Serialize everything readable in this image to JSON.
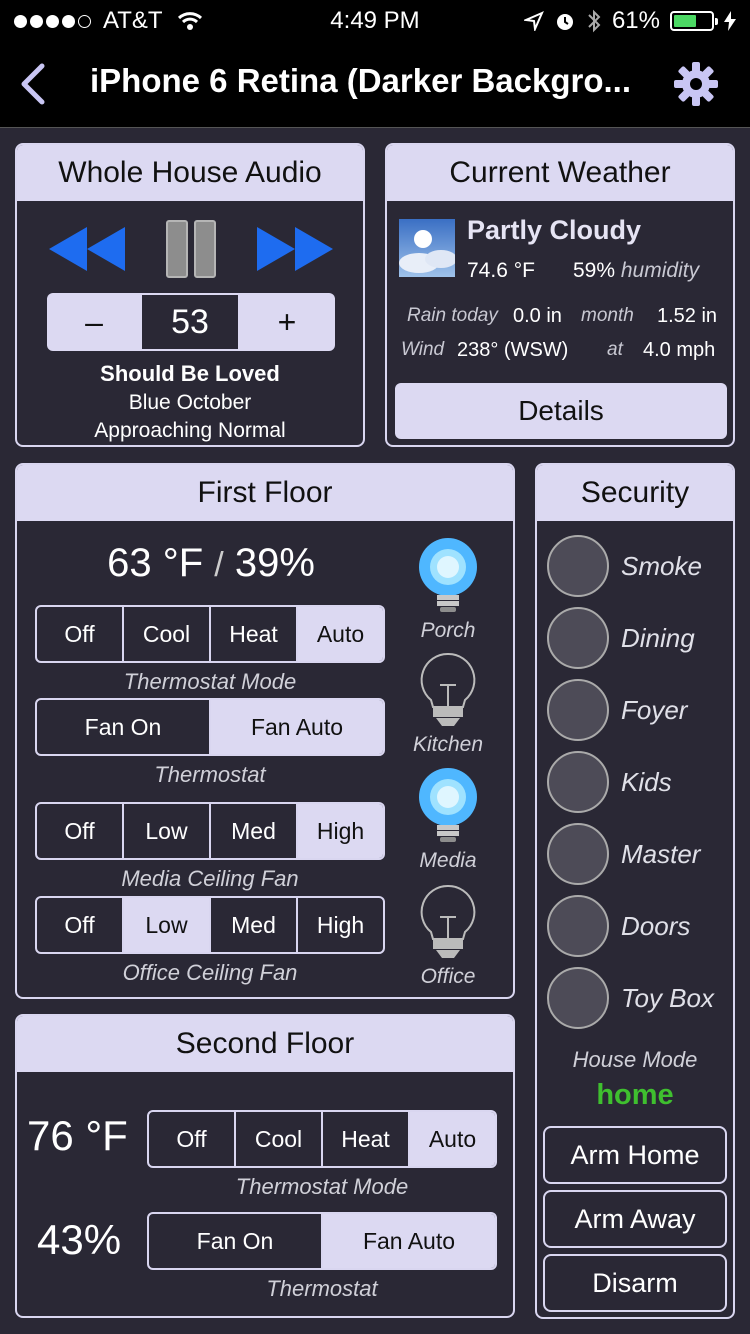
{
  "status": {
    "carrier": "AT&T",
    "time": "4:49 PM",
    "battery": "61%",
    "battery_level": 0.61
  },
  "nav": {
    "title": "iPhone 6 Retina (Darker Backgro..."
  },
  "audio": {
    "title": "Whole House Audio",
    "volume": "53",
    "minus": "–",
    "plus": "+",
    "song": "Should Be Loved",
    "artist": "Blue October",
    "album": "Approaching Normal"
  },
  "weather": {
    "title": "Current Weather",
    "condition": "Partly Cloudy",
    "temp": "74.6 °F",
    "humidity_value": "59%",
    "humidity_label": "humidity",
    "rain_label": "Rain today",
    "rain_today": "0.0 in",
    "month_label": "month",
    "rain_month": "1.52 in",
    "wind_label": "Wind",
    "wind_dir": "238° (WSW)",
    "at_label": "at",
    "wind_speed": "4.0 mph",
    "details": "Details"
  },
  "first_floor": {
    "title": "First Floor",
    "temp": "63 °F",
    "slash": "/",
    "humidity": "39%",
    "mode": {
      "options": [
        "Off",
        "Cool",
        "Heat",
        "Auto"
      ],
      "selected": "Auto",
      "caption": "Thermostat Mode"
    },
    "fan": {
      "options": [
        "Fan On",
        "Fan Auto"
      ],
      "selected": "Fan Auto",
      "caption": "Thermostat"
    },
    "media_fan": {
      "options": [
        "Off",
        "Low",
        "Med",
        "High"
      ],
      "selected": "High",
      "caption": "Media Ceiling Fan"
    },
    "office_fan": {
      "options": [
        "Off",
        "Low",
        "Med",
        "High"
      ],
      "selected": "Low",
      "caption": "Office Ceiling Fan"
    },
    "lights": [
      {
        "label": "Porch",
        "on": true
      },
      {
        "label": "Kitchen",
        "on": false
      },
      {
        "label": "Media",
        "on": true
      },
      {
        "label": "Office",
        "on": false
      }
    ]
  },
  "second_floor": {
    "title": "Second Floor",
    "temp": "76 °F",
    "humidity": "43%",
    "mode": {
      "options": [
        "Off",
        "Cool",
        "Heat",
        "Auto"
      ],
      "selected": "Auto",
      "caption": "Thermostat Mode"
    },
    "fan": {
      "options": [
        "Fan On",
        "Fan Auto"
      ],
      "selected": "Fan Auto",
      "caption": "Thermostat"
    }
  },
  "security": {
    "title": "Security",
    "zones": [
      "Smoke",
      "Dining",
      "Foyer",
      "Kids",
      "Master",
      "Doors",
      "Toy Box"
    ],
    "house_mode_label": "House Mode",
    "house_mode": "home",
    "buttons": [
      "Arm Home",
      "Arm Away",
      "Disarm"
    ]
  },
  "colors": {
    "accent_blue": "#1e6cf0",
    "panel_header": "#dcd9f2",
    "background": "#2a2835",
    "house_mode_green": "#3fbf2f",
    "bulb_on": "#4fb7ff"
  }
}
